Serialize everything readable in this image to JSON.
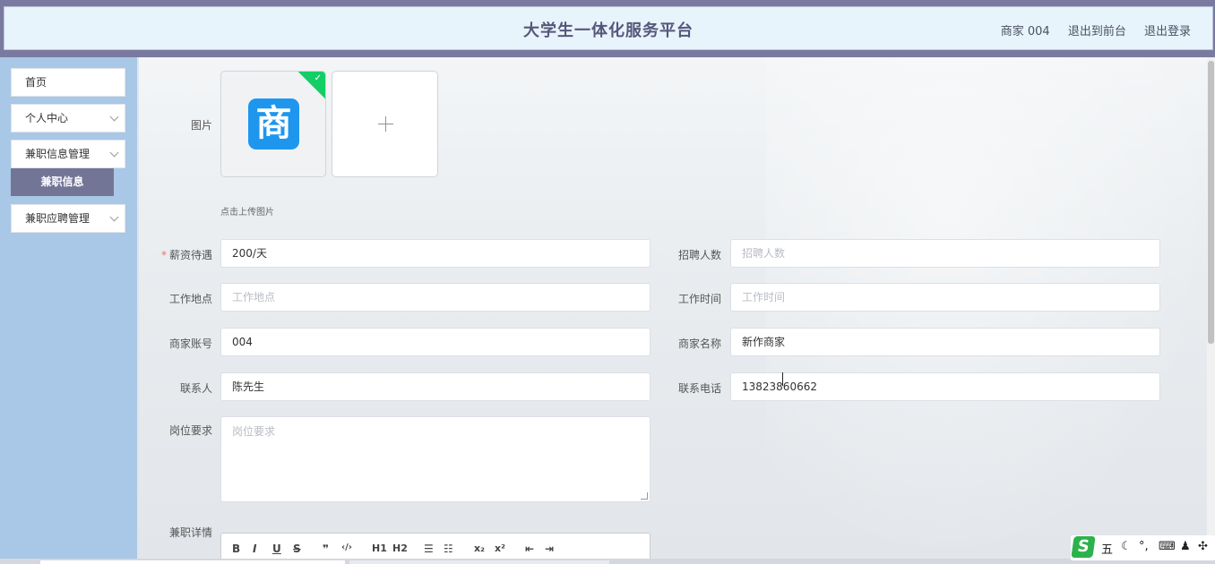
{
  "header": {
    "title": "大学生一体化服务平台",
    "user": "商家 004",
    "to_front": "退出到前台",
    "logout": "退出登录"
  },
  "sidebar": {
    "items": [
      {
        "label": "首页"
      },
      {
        "label": "个人中心"
      },
      {
        "label": "兼职信息管理"
      },
      {
        "label": "兼职应聘管理"
      }
    ],
    "active_sub": "兼职信息"
  },
  "form": {
    "image_label": "图片",
    "image_logo_char": "商",
    "upload_tip": "点击上传图片",
    "salary": {
      "label": "薪资待遇",
      "value": "200/天"
    },
    "headcount": {
      "label": "招聘人数",
      "placeholder": "招聘人数"
    },
    "location": {
      "label": "工作地点",
      "placeholder": "工作地点"
    },
    "work_time": {
      "label": "工作时间",
      "placeholder": "工作时间"
    },
    "merchant_account": {
      "label": "商家账号",
      "value": "004"
    },
    "merchant_name": {
      "label": "商家名称",
      "value": "新作商家"
    },
    "contact": {
      "label": "联系人",
      "value": "陈先生"
    },
    "phone": {
      "label": "联系电话",
      "value": "13823860662"
    },
    "requirement": {
      "label": "岗位要求",
      "placeholder": "岗位要求"
    },
    "detail": {
      "label": "兼职详情"
    }
  },
  "editor_tools": [
    "B",
    "I",
    "U",
    "S",
    "❞",
    "‹/›",
    "H1",
    "H2",
    "☰",
    "☷",
    "x₂",
    "x²",
    "⇤",
    "⇥"
  ],
  "ime": {
    "logo": "S",
    "mode": "五"
  }
}
